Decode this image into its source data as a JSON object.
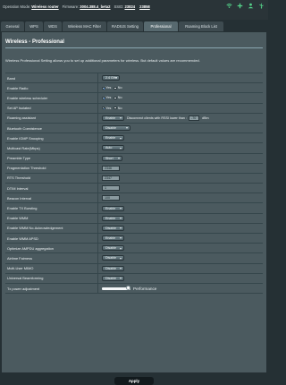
{
  "header": {
    "operation_mode_label": "Operation Mode:",
    "operation_mode_value": "Wireless router",
    "firmware_label": "Firmware:",
    "firmware_value": "3004.388.4_beta2",
    "ssid_label": "SSID:",
    "ssid_1": "23824",
    "ssid_2": "23858",
    "icons": [
      "wifi-signal-icon",
      "plus-icon",
      "user-icon",
      "usb-icon"
    ]
  },
  "tabs": [
    {
      "label": "General"
    },
    {
      "label": "WPS"
    },
    {
      "label": "WDS"
    },
    {
      "label": "Wireless MAC Filter"
    },
    {
      "label": "RADIUS Setting"
    },
    {
      "label": "Professional"
    },
    {
      "label": "Roaming Block List"
    }
  ],
  "active_tab": "Professional",
  "page": {
    "title": "Wireless - Professional",
    "description": "Wireless Professional Setting allows you to set up additional parameters for wireless. But default values are recommended."
  },
  "settings": {
    "band": {
      "label": "Band",
      "value": "2.4 GHz"
    },
    "enable_radio": {
      "label": "Enable Radio",
      "yes": "Yes",
      "no": "No",
      "selected": "Yes"
    },
    "enable_wireless_scheduler": {
      "label": "Enable wireless scheduler",
      "yes": "Yes",
      "no": "No",
      "selected": "Yes"
    },
    "set_ap_isolated": {
      "label": "Set AP Isolated",
      "yes": "Yes",
      "no": "No",
      "selected": "Yes"
    },
    "roaming_assistant": {
      "label": "Roaming assistant",
      "value": "Enable",
      "text": "Disconnect clients with RSSI lower than :",
      "rssi": "-70",
      "unit": "dBm"
    },
    "bluetooth_coexistence": {
      "label": "Bluetooth Coexistence",
      "value": "Disable"
    },
    "enable_igmp_snooping": {
      "label": "Enable IGMP Snooping",
      "value": "Enable"
    },
    "multicast_rate": {
      "label": "Multicast Rate(Mbps)",
      "value": "Auto"
    },
    "preamble_type": {
      "label": "Preamble Type",
      "value": "Short"
    },
    "fragmentation_threshold": {
      "label": "Fragmentation Threshold",
      "value": "2346"
    },
    "rts_threshold": {
      "label": "RTS Threshold",
      "value": "2347"
    },
    "dtim_interval": {
      "label": "DTIM Interval",
      "value": "1"
    },
    "beacon_interval": {
      "label": "Beacon Interval",
      "value": "100"
    },
    "enable_tx_bursting": {
      "label": "Enable TX Bursting",
      "value": "Enable"
    },
    "enable_wmm": {
      "label": "Enable WMM",
      "value": "Enable"
    },
    "enable_wmm_no_ack": {
      "label": "Enable WMM No-Acknowledgement",
      "value": "Disable"
    },
    "enable_wmm_apsd": {
      "label": "Enable WMM APSD",
      "value": "Enable"
    },
    "optimize_ampdu": {
      "label": "Optimize AMPDU aggregation",
      "value": "Disable"
    },
    "airtime_fairness": {
      "label": "Airtime Fairness",
      "value": "Disable"
    },
    "multi_user_mimo": {
      "label": "Multi-User MIMO",
      "value": "Disable"
    },
    "universal_beamforming": {
      "label": "Universal Beamforming",
      "value": "Disable"
    },
    "tx_power": {
      "label": "Tx power adjustment",
      "value_text": "Performance",
      "level": 1.0
    }
  },
  "apply_label": "Apply"
}
